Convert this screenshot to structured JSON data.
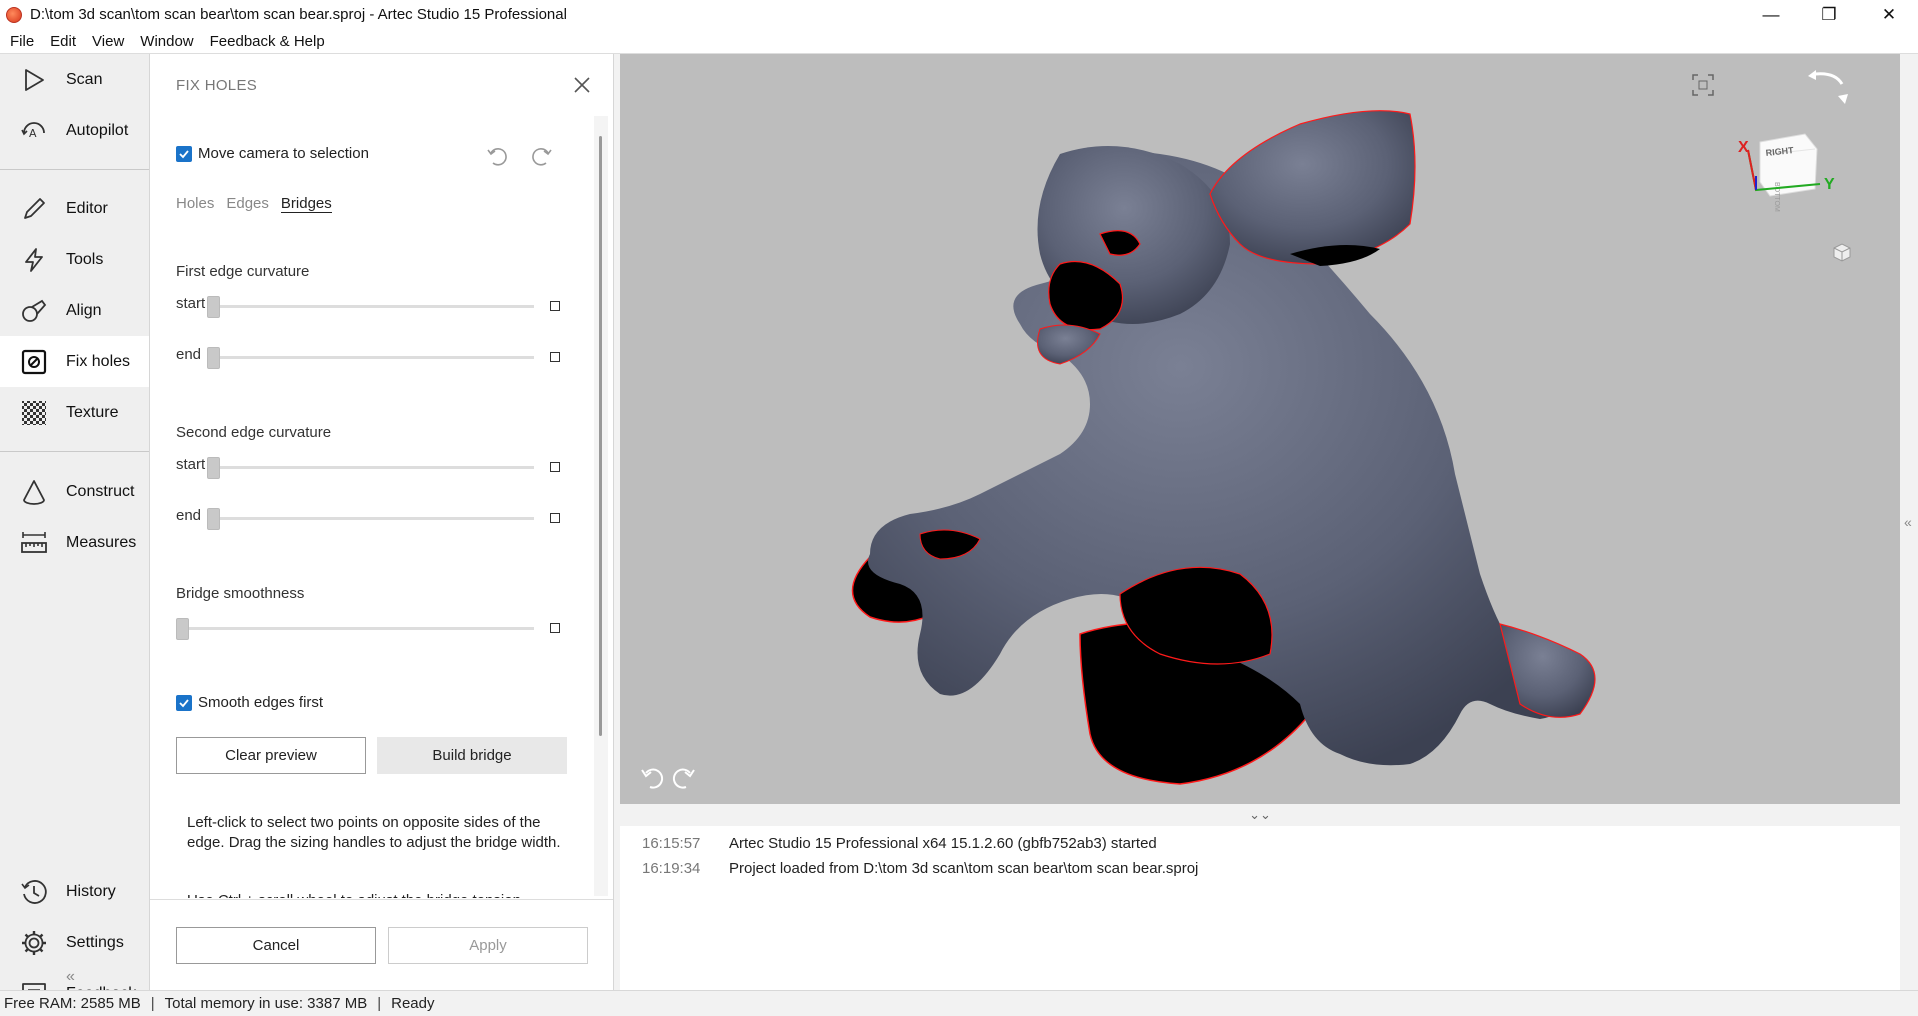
{
  "window": {
    "title": "D:\\tom 3d scan\\tom scan bear\\tom scan bear.sproj - Artec Studio 15 Professional",
    "minimize": "—",
    "maximize": "❐",
    "close": "✕"
  },
  "menu": [
    "File",
    "Edit",
    "View",
    "Window",
    "Feedback & Help"
  ],
  "nav": {
    "scan": "Scan",
    "autopilot": "Autopilot",
    "editor": "Editor",
    "tools": "Tools",
    "align": "Align",
    "fix_holes": "Fix holes",
    "texture": "Texture",
    "construct": "Construct",
    "measures": "Measures",
    "history": "History",
    "settings": "Settings",
    "feedback": "Feedback",
    "collapse": "«"
  },
  "panel": {
    "title": "FIX HOLES",
    "move_camera": {
      "label": "Move camera to selection",
      "checked": true
    },
    "tabs": [
      "Holes",
      "Edges",
      "Bridges"
    ],
    "active_tab": "Bridges",
    "first_edge": {
      "label": "First edge curvature",
      "start_label": "start",
      "end_label": "end",
      "start_value": 0,
      "end_value": 0
    },
    "second_edge": {
      "label": "Second edge curvature",
      "start_label": "start",
      "end_label": "end",
      "start_value": 0,
      "end_value": 0
    },
    "smoothness": {
      "label": "Bridge smoothness",
      "value": 0
    },
    "smooth_edges": {
      "label": "Smooth edges first",
      "checked": true
    },
    "clear_preview": "Clear preview",
    "build_bridge": "Build bridge",
    "help": "Left-click to select two points on opposite sides of the edge. Drag the sizing handles to adjust the bridge width.",
    "help_cut": "Use Ctrl + scroll wheel to adjust the bridge tension",
    "cancel": "Cancel",
    "apply": "Apply"
  },
  "viewport": {
    "gizmo": {
      "face_right": "RIGHT",
      "face_bottom": "BOTTOM",
      "axis_x": "X",
      "axis_y": "Y"
    },
    "log_toggle": "⌄⌄",
    "right_collapse": "«"
  },
  "log": [
    {
      "time": "16:15:57",
      "message": "Artec Studio 15 Professional x64 15.1.2.60 (gbfb752ab3) started"
    },
    {
      "time": "16:19:34",
      "message": "Project loaded from D:\\tom 3d scan\\tom scan bear\\tom scan bear.sproj"
    }
  ],
  "status": {
    "free_ram": "Free RAM: 2585 MB",
    "total_memory": "Total memory in use: 3387 MB",
    "state": "Ready",
    "sep": "|"
  },
  "colors": {
    "accent": "#1a73c9",
    "mesh": "#5e6478",
    "hole_edge": "#ff1a1a",
    "viewport_bg": "#bdbdbd"
  }
}
